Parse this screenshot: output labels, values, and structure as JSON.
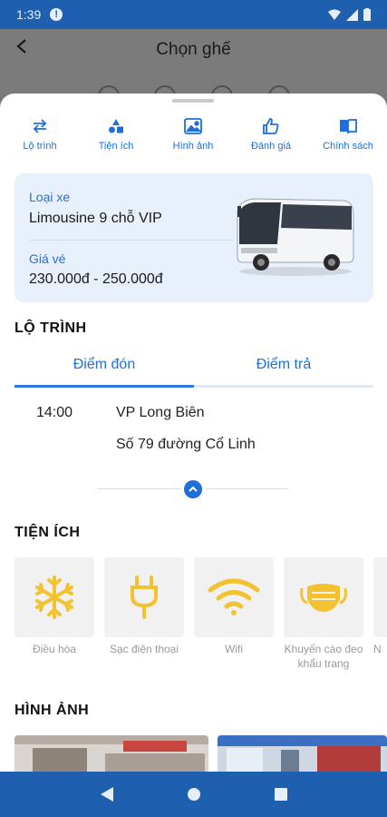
{
  "status_bar": {
    "time": "1:39",
    "alert": "!"
  },
  "header": {
    "title": "Chọn ghế",
    "back_icon": "arrow-left-icon"
  },
  "quick_tabs": [
    {
      "label": "Lộ trình",
      "icon": "swap-arrows-icon"
    },
    {
      "label": "Tiện ích",
      "icon": "shapes-icon"
    },
    {
      "label": "Hình ảnh",
      "icon": "image-icon"
    },
    {
      "label": "Đánh giá",
      "icon": "thumbs-up-icon"
    },
    {
      "label": "Chính sách",
      "icon": "book-icon"
    }
  ],
  "vehicle": {
    "type_label": "Loại xe",
    "type_value": "Limousine 9 chỗ VIP",
    "price_label": "Giá vé",
    "price_value": "230.000đ - 250.000đ"
  },
  "route": {
    "section_title": "LỘ TRÌNH",
    "tabs": [
      "Điểm đón",
      "Điểm trả"
    ],
    "active_tab": 0,
    "stop": {
      "time": "14:00",
      "name": "VP Long Biên",
      "address": "Số 79 đường Cổ Linh"
    }
  },
  "amenities": {
    "section_title": "TIỆN ÍCH",
    "items": [
      {
        "label": "Điều hòa",
        "icon": "snowflake-icon"
      },
      {
        "label": "Sạc điện thoại",
        "icon": "plug-icon"
      },
      {
        "label": "Wifi",
        "icon": "wifi-icon"
      },
      {
        "label": "Khuyến cáo đeo khẩu trang",
        "icon": "face-mask-icon"
      },
      {
        "label": "N",
        "icon": "more-amenity-icon"
      }
    ],
    "icon_color": "#f2c230"
  },
  "photos": {
    "section_title": "HÌNH ẢNH"
  },
  "colors": {
    "primary": "#1e6fd9",
    "bar": "#1e5fb0",
    "card_bg": "#e8f0fb"
  }
}
